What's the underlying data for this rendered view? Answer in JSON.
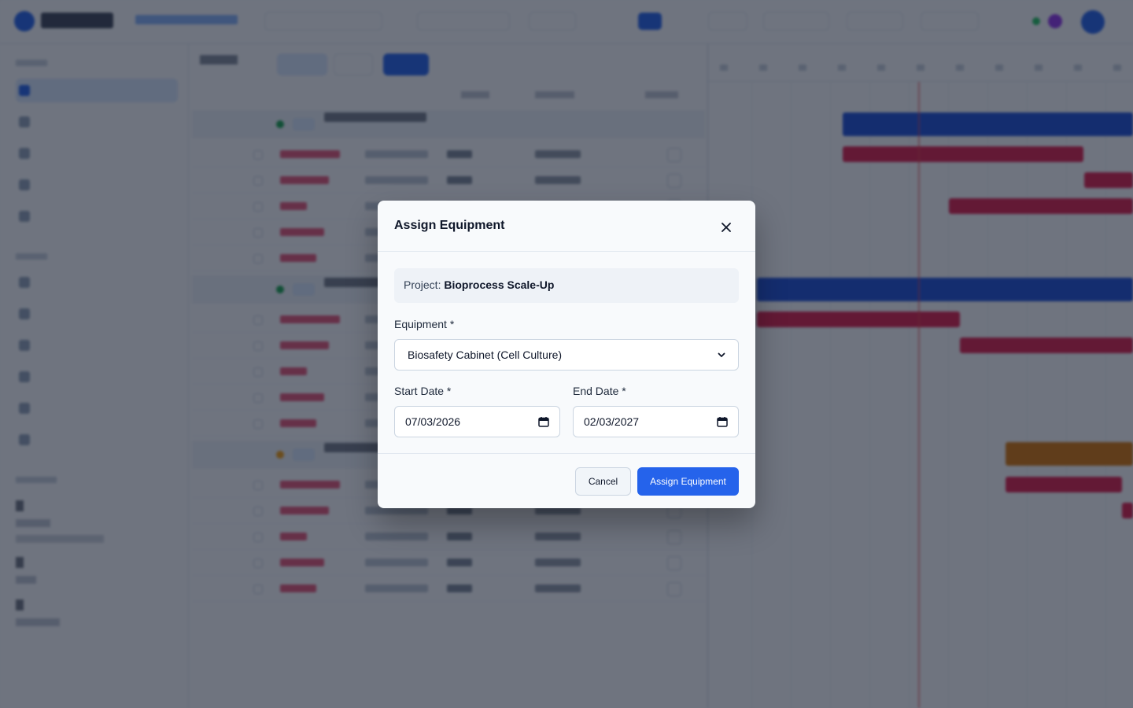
{
  "modal": {
    "title": "Assign Equipment",
    "project_prefix": "Project: ",
    "project_name": "Bioprocess Scale-Up",
    "equipment_label": "Equipment *",
    "equipment_value": "Biosafety Cabinet (Cell Culture)",
    "start_label": "Start Date *",
    "start_value": "07/03/2026",
    "end_label": "End Date *",
    "end_value": "02/03/2027",
    "cancel_label": "Cancel",
    "submit_label": "Assign Equipment"
  },
  "colors": {
    "primary": "#2563eb",
    "overlay": "rgba(15, 23, 42, 0.6)",
    "bar_blue": "#1d4ed8",
    "bar_pink": "#e11d48",
    "bar_amber": "#d97706"
  },
  "icons": {
    "close": "close-icon",
    "select_chevron": "chevron-down-icon",
    "calendar": "calendar-icon"
  }
}
